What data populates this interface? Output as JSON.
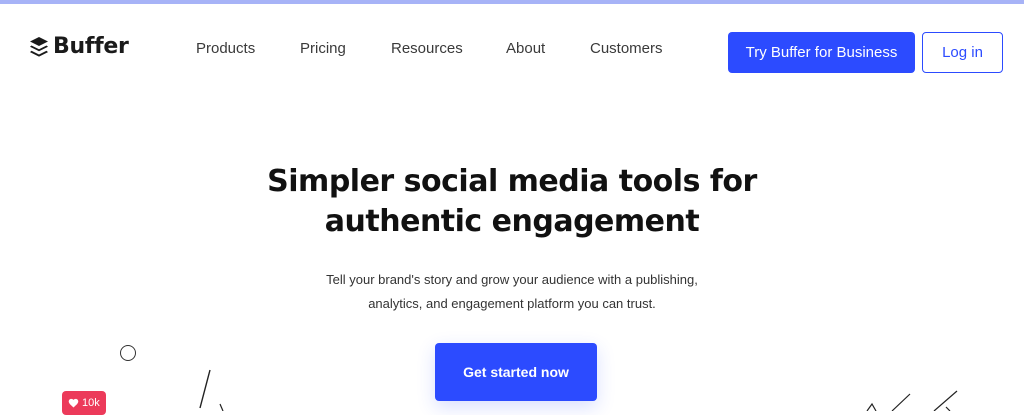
{
  "brand": {
    "name": "Buffer",
    "accent": "#2c4bff",
    "like_color": "#ec3a5a"
  },
  "nav": {
    "items": [
      {
        "label": "Products"
      },
      {
        "label": "Pricing"
      },
      {
        "label": "Resources"
      },
      {
        "label": "About"
      },
      {
        "label": "Customers"
      }
    ],
    "cta_label": "Try Buffer for Business",
    "login_label": "Log in"
  },
  "hero": {
    "title_line1": "Simpler social media tools for",
    "title_line2": "authentic engagement",
    "subtitle_line1": "Tell your brand's story and grow your audience with a publishing,",
    "subtitle_line2": "analytics, and engagement platform you can trust.",
    "cta_label": "Get started now"
  },
  "decor": {
    "like_badge_text": "10k",
    "icons": [
      "buffer-logo-icon",
      "heart-icon"
    ]
  }
}
